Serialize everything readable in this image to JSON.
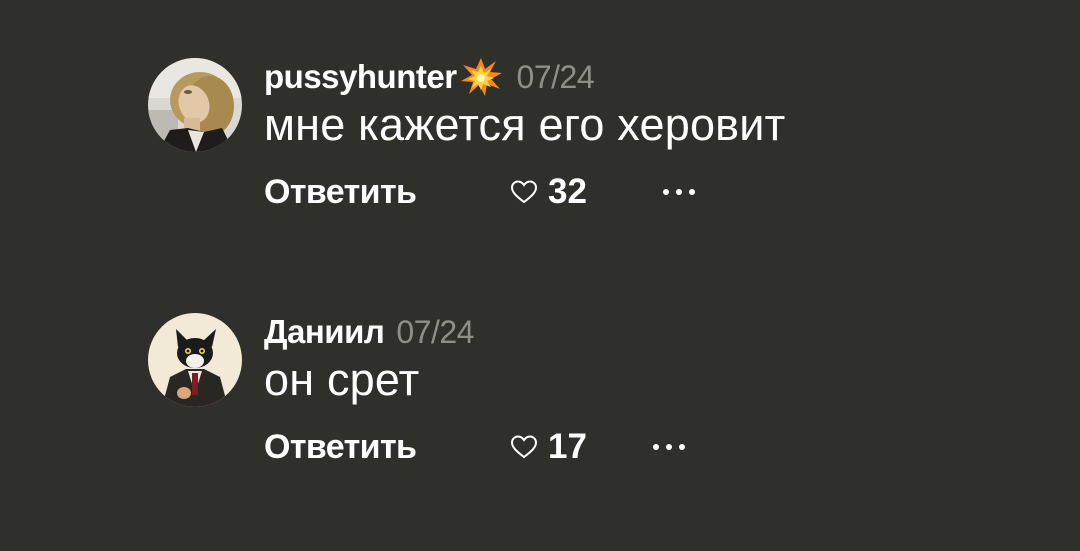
{
  "comments": [
    {
      "username": "pussyhunter",
      "username_emoji": "collision-emoji",
      "date": "07/24",
      "text": "мне кажется его херовит",
      "reply_label": "Ответить",
      "likes": "32",
      "avatar": "man-looking-up-photo"
    },
    {
      "username": "Даниил",
      "date": "07/24",
      "text": "он срет",
      "reply_label": "Ответить",
      "likes": "17",
      "avatar": "cat-in-suit-photo"
    }
  ],
  "icons": {
    "like": "heart-outline-icon",
    "more": "more-dots-icon"
  },
  "colors": {
    "background": "#2f2f2b",
    "text": "#ffffff",
    "muted": "#8f8f8a",
    "emoji_orange": "#f5891f",
    "emoji_yellow": "#ffd23f"
  }
}
